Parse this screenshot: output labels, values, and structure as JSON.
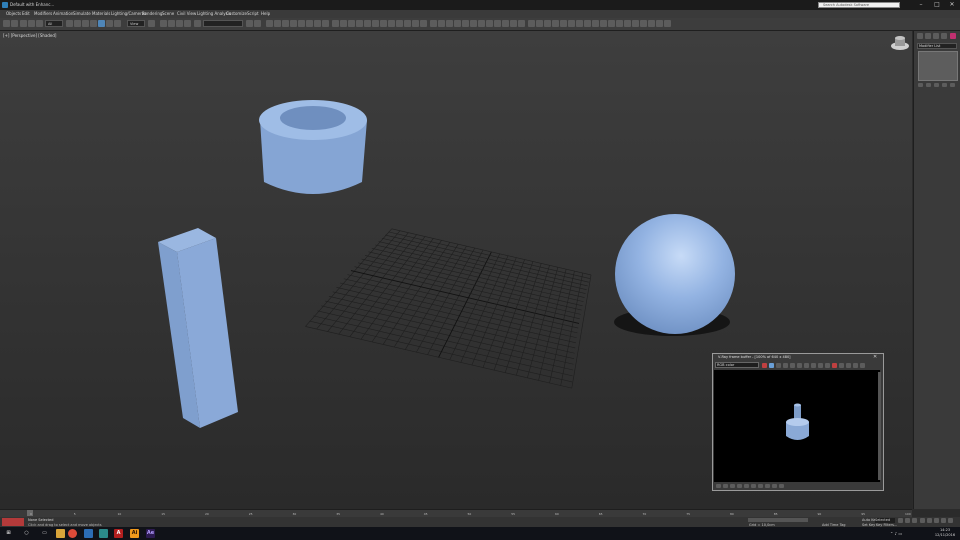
{
  "titlebar": {
    "title": "Default with Enhanc...",
    "help_search_placeholder": "Search Autodesk Software",
    "controls": [
      "–",
      "□",
      "✕"
    ]
  },
  "menus": [
    "Objects",
    "Edit",
    "Modifiers",
    "Animation",
    "Simulate",
    "Materials",
    "Lighting/Cameras",
    "Rendering",
    "Scene",
    "Civil View",
    "Lighting Analysis",
    "Customize",
    "Script",
    "Help"
  ],
  "toolbar": {
    "selection_filter": "All",
    "coordinate_system": "View"
  },
  "viewport": {
    "label": "[+] [Perspective] [Shaded]",
    "object_color": "#86a9d6"
  },
  "command_panel": {
    "object_name": "Modifier List"
  },
  "framebuffer": {
    "title": "V-Ray frame buffer - [100% of 640 x 480]",
    "channel": "RGB color"
  },
  "status": {
    "selection": "None Selected",
    "hint": "Click and drag to select and move objects",
    "keymode": "Auto Key",
    "selected_label": "Selected",
    "setkey_label": "Set Key",
    "keyfilters_label": "Key Filters...",
    "addtimetag": "Add Time Tag",
    "grid": "Grid = 10,0cm"
  },
  "taskbar": {
    "time": "14:23",
    "date": "12/11/2016",
    "apps": [
      "start",
      "search",
      "taskview",
      "explorer",
      "chrome",
      "files",
      "3dsmax",
      "acrobat",
      "illustrator",
      "aftereffects"
    ]
  },
  "timeline": {
    "frames": [
      "0",
      "5",
      "10",
      "15",
      "20",
      "25",
      "30",
      "35",
      "40",
      "45",
      "50",
      "55",
      "60",
      "65",
      "70",
      "75",
      "80",
      "85",
      "90",
      "95",
      "100"
    ]
  }
}
